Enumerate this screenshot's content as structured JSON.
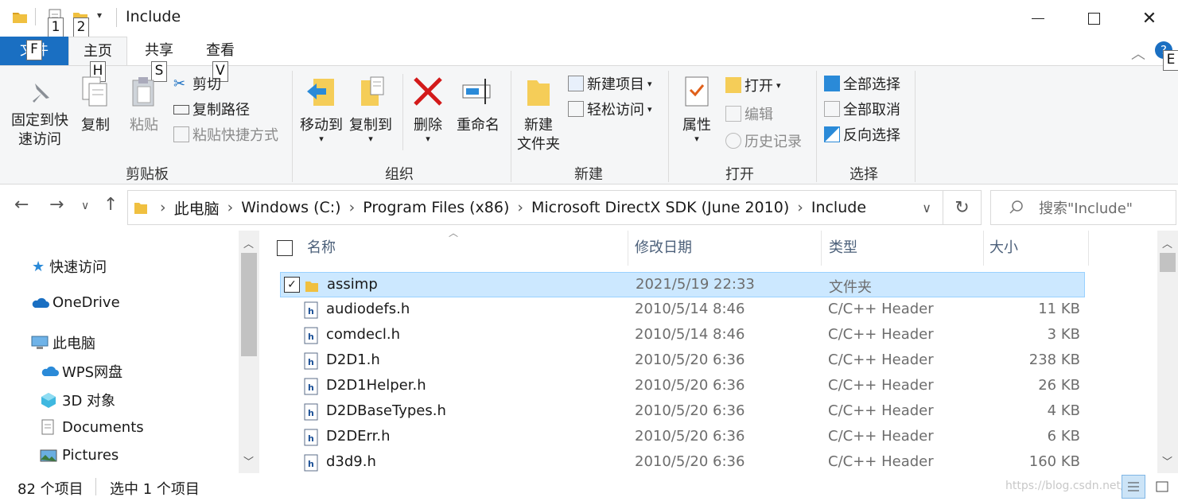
{
  "window": {
    "title": "Include",
    "keytips": {
      "qa1": "1",
      "qa2": "2",
      "file": "F",
      "home": "H",
      "share": "S",
      "view": "V",
      "help": "E"
    }
  },
  "tabs": {
    "file": "文件",
    "home": "主页",
    "share": "共享",
    "view": "查看"
  },
  "ribbon": {
    "clipboard": {
      "pin_label_1": "固定到快",
      "pin_label_2": "速访问",
      "copy": "复制",
      "paste": "粘贴",
      "cut": "剪切",
      "copy_path": "复制路径",
      "paste_shortcut": "粘贴快捷方式",
      "group": "剪贴板"
    },
    "organize": {
      "move_to": "移动到",
      "copy_to": "复制到",
      "delete": "删除",
      "rename": "重命名",
      "group": "组织"
    },
    "new": {
      "new_folder_1": "新建",
      "new_folder_2": "文件夹",
      "new_item": "新建项目",
      "easy_access": "轻松访问",
      "group": "新建"
    },
    "open": {
      "properties": "属性",
      "open": "打开",
      "edit": "编辑",
      "history": "历史记录",
      "group": "打开"
    },
    "select": {
      "select_all": "全部选择",
      "select_none": "全部取消",
      "invert": "反向选择",
      "group": "选择"
    }
  },
  "address": {
    "crumbs": [
      "此电脑",
      "Windows (C:)",
      "Program Files (x86)",
      "Microsoft DirectX SDK (June 2010)",
      "Include"
    ],
    "search_placeholder": "搜索\"Include\""
  },
  "navpane": {
    "quick_access": "快速访问",
    "onedrive": "OneDrive",
    "this_pc": "此电脑",
    "wps": "WPS网盘",
    "objects3d": "3D 对象",
    "documents": "Documents",
    "pictures": "Pictures"
  },
  "filelist": {
    "headers": {
      "name": "名称",
      "date": "修改日期",
      "type": "类型",
      "size": "大小"
    },
    "rows": [
      {
        "name": "assimp",
        "date": "2021/5/19 22:33",
        "type": "文件夹",
        "size": ""
      },
      {
        "name": "audiodefs.h",
        "date": "2010/5/14 8:46",
        "type": "C/C++ Header",
        "size": "11 KB"
      },
      {
        "name": "comdecl.h",
        "date": "2010/5/14 8:46",
        "type": "C/C++ Header",
        "size": "3 KB"
      },
      {
        "name": "D2D1.h",
        "date": "2010/5/20 6:36",
        "type": "C/C++ Header",
        "size": "238 KB"
      },
      {
        "name": "D2D1Helper.h",
        "date": "2010/5/20 6:36",
        "type": "C/C++ Header",
        "size": "26 KB"
      },
      {
        "name": "D2DBaseTypes.h",
        "date": "2010/5/20 6:36",
        "type": "C/C++ Header",
        "size": "4 KB"
      },
      {
        "name": "D2DErr.h",
        "date": "2010/5/20 6:36",
        "type": "C/C++ Header",
        "size": "6 KB"
      },
      {
        "name": "d3d9.h",
        "date": "2010/5/20 6:36",
        "type": "C/C++ Header",
        "size": "160 KB"
      }
    ]
  },
  "status": {
    "count": "82 个项目",
    "selected": "选中 1 个项目",
    "watermark": "https://blog.csdn.net/..."
  }
}
